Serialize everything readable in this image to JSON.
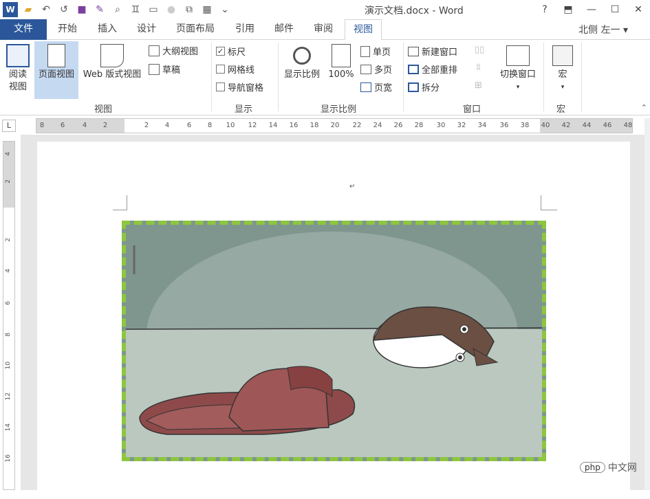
{
  "window": {
    "title": "演示文档.docx - Word",
    "help": "?",
    "min": "—",
    "max": "☐",
    "close": "✕"
  },
  "qat": {
    "word_icon": "W",
    "open_icon": "📂",
    "undo_icon": "↶",
    "redo_icon": "↺",
    "save_icon": "💾",
    "edit_icon": "✎",
    "preview_icon": "🔍",
    "binoc_icon": "⚲",
    "doc_icon": "▭",
    "circle_icon": "●",
    "table_icon": "▦",
    "more_icon": "⌄"
  },
  "tabs": {
    "file": "文件",
    "home": "开始",
    "insert": "插入",
    "design": "设计",
    "layout": "页面布局",
    "references": "引用",
    "mailings": "邮件",
    "review": "审阅",
    "view": "视图"
  },
  "user": "北侧 左一 ▾",
  "ribbon": {
    "views": {
      "read": "阅读\n视图",
      "read_l1": "阅读",
      "read_l2": "视图",
      "print": "页面视图",
      "web": "Web 版式视图",
      "outline": "大纲视图",
      "draft": "草稿",
      "label": "视图"
    },
    "show": {
      "ruler": "标尺",
      "gridlines": "网格线",
      "nav": "导航窗格",
      "label": "显示",
      "ruler_checked": "✓"
    },
    "zoom": {
      "zoom": "显示比例",
      "hundred": "100%",
      "one": "单页",
      "multi": "多页",
      "width": "页宽",
      "label": "显示比例"
    },
    "window": {
      "new": "新建窗口",
      "arrange": "全部重排",
      "split": "拆分",
      "switch": "切换窗口",
      "label": "窗口"
    },
    "macros": {
      "macro": "宏",
      "label": "宏"
    }
  },
  "ruler": {
    "corner": "L",
    "ticks": [
      "8",
      "6",
      "4",
      "2",
      "2",
      "4",
      "6",
      "8",
      "10",
      "12",
      "14",
      "16",
      "18",
      "20",
      "22",
      "24",
      "26",
      "28",
      "30",
      "32",
      "34",
      "36",
      "38",
      "40",
      "42",
      "44",
      "46",
      "48"
    ],
    "vticks": [
      "4",
      "2",
      "2",
      "4",
      "6",
      "8",
      "10",
      "12",
      "14",
      "16"
    ]
  },
  "doc": {
    "paragraph_mark": "↵"
  },
  "watermark": {
    "php": "php",
    "text": "中文网"
  },
  "colors": {
    "accent": "#2b579a",
    "frame": "#8dc63f"
  }
}
